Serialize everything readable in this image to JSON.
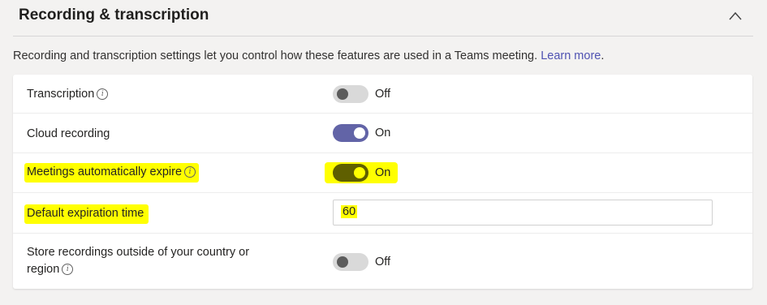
{
  "section": {
    "title": "Recording & transcription",
    "collapse_icon": "chevron-up-icon"
  },
  "description": {
    "text": "Recording and transcription settings let you control how these features are used in a Teams meeting.",
    "link_label": "Learn more",
    "trailing": "."
  },
  "settings": {
    "transcription": {
      "label": "Transcription",
      "info_icon": "i",
      "state": "Off",
      "enabled": false
    },
    "cloud_recording": {
      "label": "Cloud recording",
      "state": "On",
      "enabled": true
    },
    "auto_expire": {
      "label": "Meetings automatically expire",
      "info_icon": "i",
      "state": "On",
      "enabled": true
    },
    "default_expiration": {
      "label": "Default expiration time",
      "value": "60"
    },
    "store_outside": {
      "label_line1": "Store recordings outside of your country or",
      "label_line2": "region",
      "info_icon": "i",
      "state": "Off",
      "enabled": false
    }
  },
  "colors": {
    "accent": "#6264a7",
    "highlight": "#ffff00",
    "link": "#4f52b2"
  }
}
